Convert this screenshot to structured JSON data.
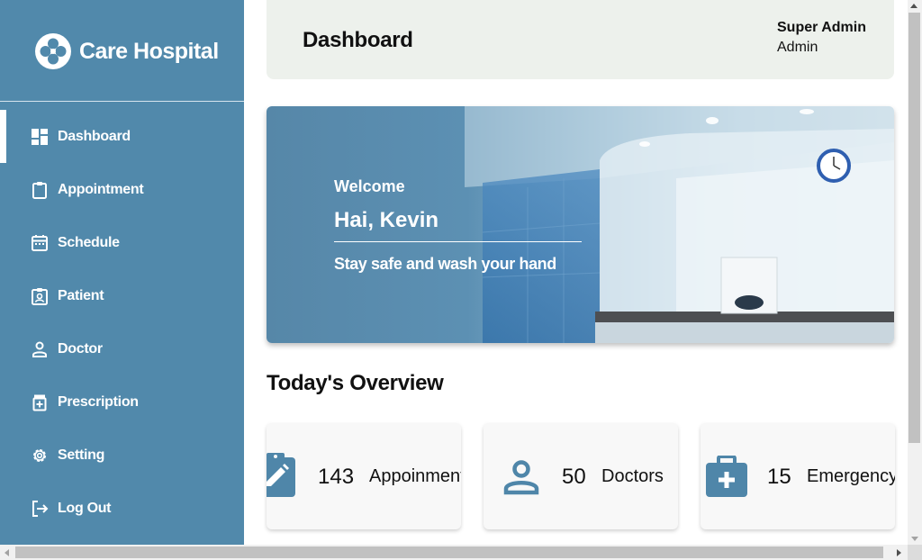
{
  "brand": {
    "name": "Care Hospital",
    "icon": "hospital-logo-icon"
  },
  "sidebar": {
    "items": [
      {
        "label": "Dashboard",
        "icon": "dashboard-icon",
        "active": true
      },
      {
        "label": "Appointment",
        "icon": "clipboard-icon",
        "active": false
      },
      {
        "label": "Schedule",
        "icon": "calendar-icon",
        "active": false
      },
      {
        "label": "Patient",
        "icon": "patient-badge-icon",
        "active": false
      },
      {
        "label": "Doctor",
        "icon": "person-icon",
        "active": false
      },
      {
        "label": "Prescription",
        "icon": "medicine-icon",
        "active": false
      },
      {
        "label": "Setting",
        "icon": "gear-icon",
        "active": false
      },
      {
        "label": "Log Out",
        "icon": "logout-icon",
        "active": false
      }
    ]
  },
  "header": {
    "title": "Dashboard",
    "user_name": "Super Admin",
    "user_role": "Admin"
  },
  "hero": {
    "welcome": "Welcome",
    "greeting": "Hai, Kevin",
    "tagline": "Stay safe and wash your hand"
  },
  "overview": {
    "title": "Today's Overview",
    "cards": [
      {
        "count": "143",
        "label": "Appoinment",
        "icon": "clipboard-edit-icon"
      },
      {
        "count": "50",
        "label": "Doctors",
        "icon": "person-icon"
      },
      {
        "count": "15",
        "label": "Emergency",
        "icon": "medical-kit-icon"
      }
    ]
  },
  "colors": {
    "sidebar": "#5189ab",
    "accent": "#4f86a9",
    "header_bg": "#edf1ec",
    "card_bg": "#f8f8f8"
  }
}
